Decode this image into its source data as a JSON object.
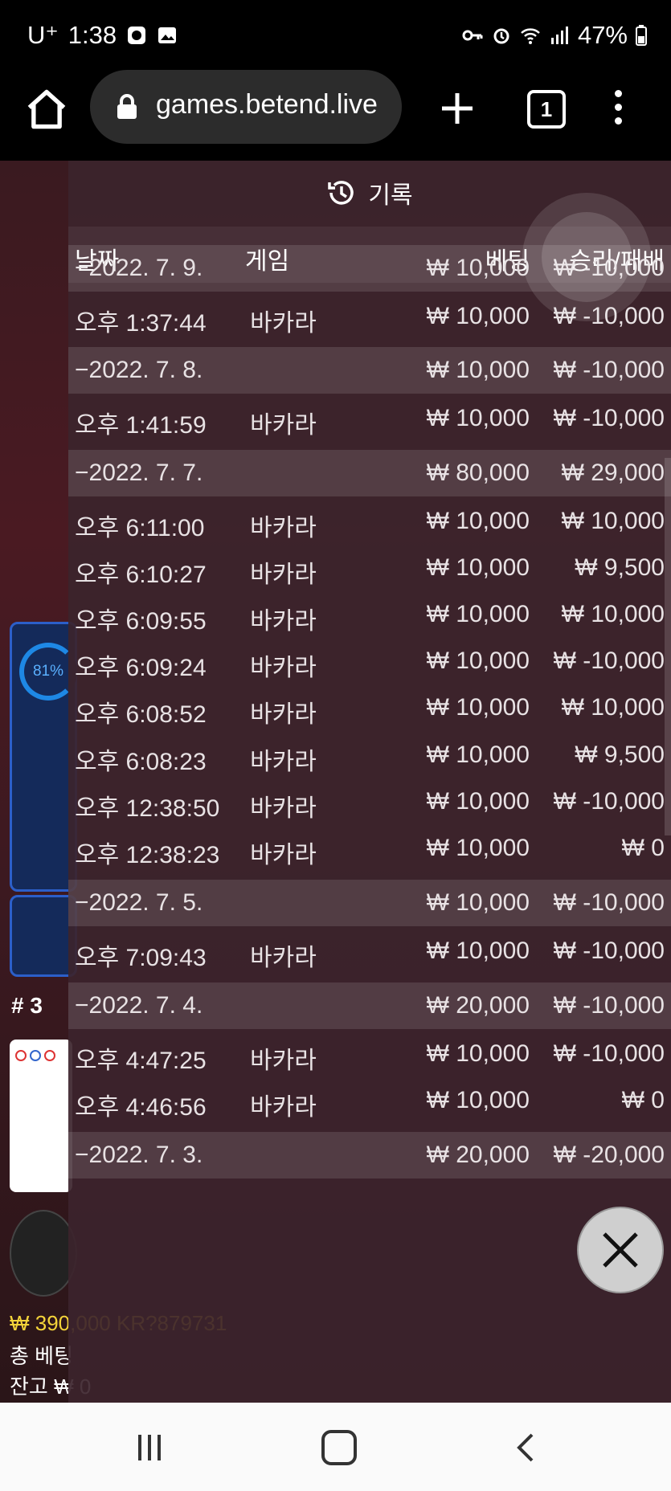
{
  "status_bar": {
    "carrier": "U⁺",
    "time": "1:38",
    "battery": "47%"
  },
  "browser": {
    "url": "games.betend.live",
    "tab_count": "1"
  },
  "panel": {
    "title": "기록",
    "headers": {
      "date": "날짜",
      "game": "게임",
      "bet": "베팅",
      "result": "승리/패배"
    },
    "rows": [
      {
        "type": "date",
        "date": "−2022. 7. 9.",
        "game": "",
        "bet": "₩ 10,000",
        "result": "₩ -10,000"
      },
      {
        "type": "entry",
        "date": "오후 1:37:44",
        "game": "바카라",
        "bet": "₩ 10,000",
        "result": "₩ -10,000"
      },
      {
        "type": "date",
        "date": "−2022. 7. 8.",
        "game": "",
        "bet": "₩ 10,000",
        "result": "₩ -10,000"
      },
      {
        "type": "entry",
        "date": "오후 1:41:59",
        "game": "바카라",
        "bet": "₩ 10,000",
        "result": "₩ -10,000"
      },
      {
        "type": "date",
        "date": "−2022. 7. 7.",
        "game": "",
        "bet": "₩ 80,000",
        "result": "₩ 29,000"
      },
      {
        "type": "entry",
        "date": "오후 6:11:00",
        "game": "바카라",
        "bet": "₩ 10,000",
        "result": "₩ 10,000"
      },
      {
        "type": "entry",
        "date": "오후 6:10:27",
        "game": "바카라",
        "bet": "₩ 10,000",
        "result": "₩ 9,500"
      },
      {
        "type": "entry",
        "date": "오후 6:09:55",
        "game": "바카라",
        "bet": "₩ 10,000",
        "result": "₩ 10,000"
      },
      {
        "type": "entry",
        "date": "오후 6:09:24",
        "game": "바카라",
        "bet": "₩ 10,000",
        "result": "₩ -10,000"
      },
      {
        "type": "entry",
        "date": "오후 6:08:52",
        "game": "바카라",
        "bet": "₩ 10,000",
        "result": "₩ 10,000"
      },
      {
        "type": "entry",
        "date": "오후 6:08:23",
        "game": "바카라",
        "bet": "₩ 10,000",
        "result": "₩ 9,500"
      },
      {
        "type": "entry",
        "date": "오후 12:38:50",
        "game": "바카라",
        "bet": "₩ 10,000",
        "result": "₩ -10,000"
      },
      {
        "type": "entry",
        "date": "오후 12:38:23",
        "game": "바카라",
        "bet": "₩ 10,000",
        "result": "₩ 0"
      },
      {
        "type": "date",
        "date": "−2022. 7. 5.",
        "game": "",
        "bet": "₩ 10,000",
        "result": "₩ -10,000"
      },
      {
        "type": "entry",
        "date": "오후 7:09:43",
        "game": "바카라",
        "bet": "₩ 10,000",
        "result": "₩ -10,000"
      },
      {
        "type": "date",
        "date": "−2022. 7. 4.",
        "game": "",
        "bet": "₩ 20,000",
        "result": "₩ -10,000"
      },
      {
        "type": "entry",
        "date": "오후 4:47:25",
        "game": "바카라",
        "bet": "₩ 10,000",
        "result": "₩ -10,000"
      },
      {
        "type": "entry",
        "date": "오후 4:46:56",
        "game": "바카라",
        "bet": "₩ 10,000",
        "result": "₩ 0"
      },
      {
        "type": "date",
        "date": "−2022. 7. 3.",
        "game": "",
        "bet": "₩ 20,000",
        "result": "₩ -20,000"
      }
    ]
  },
  "background": {
    "percent": "81%",
    "round": "# 3",
    "balance_line": "₩ 390,000 KR?879731",
    "total_bet_label": "총 베팅",
    "balance_label": "잔고 ₩ 0"
  }
}
